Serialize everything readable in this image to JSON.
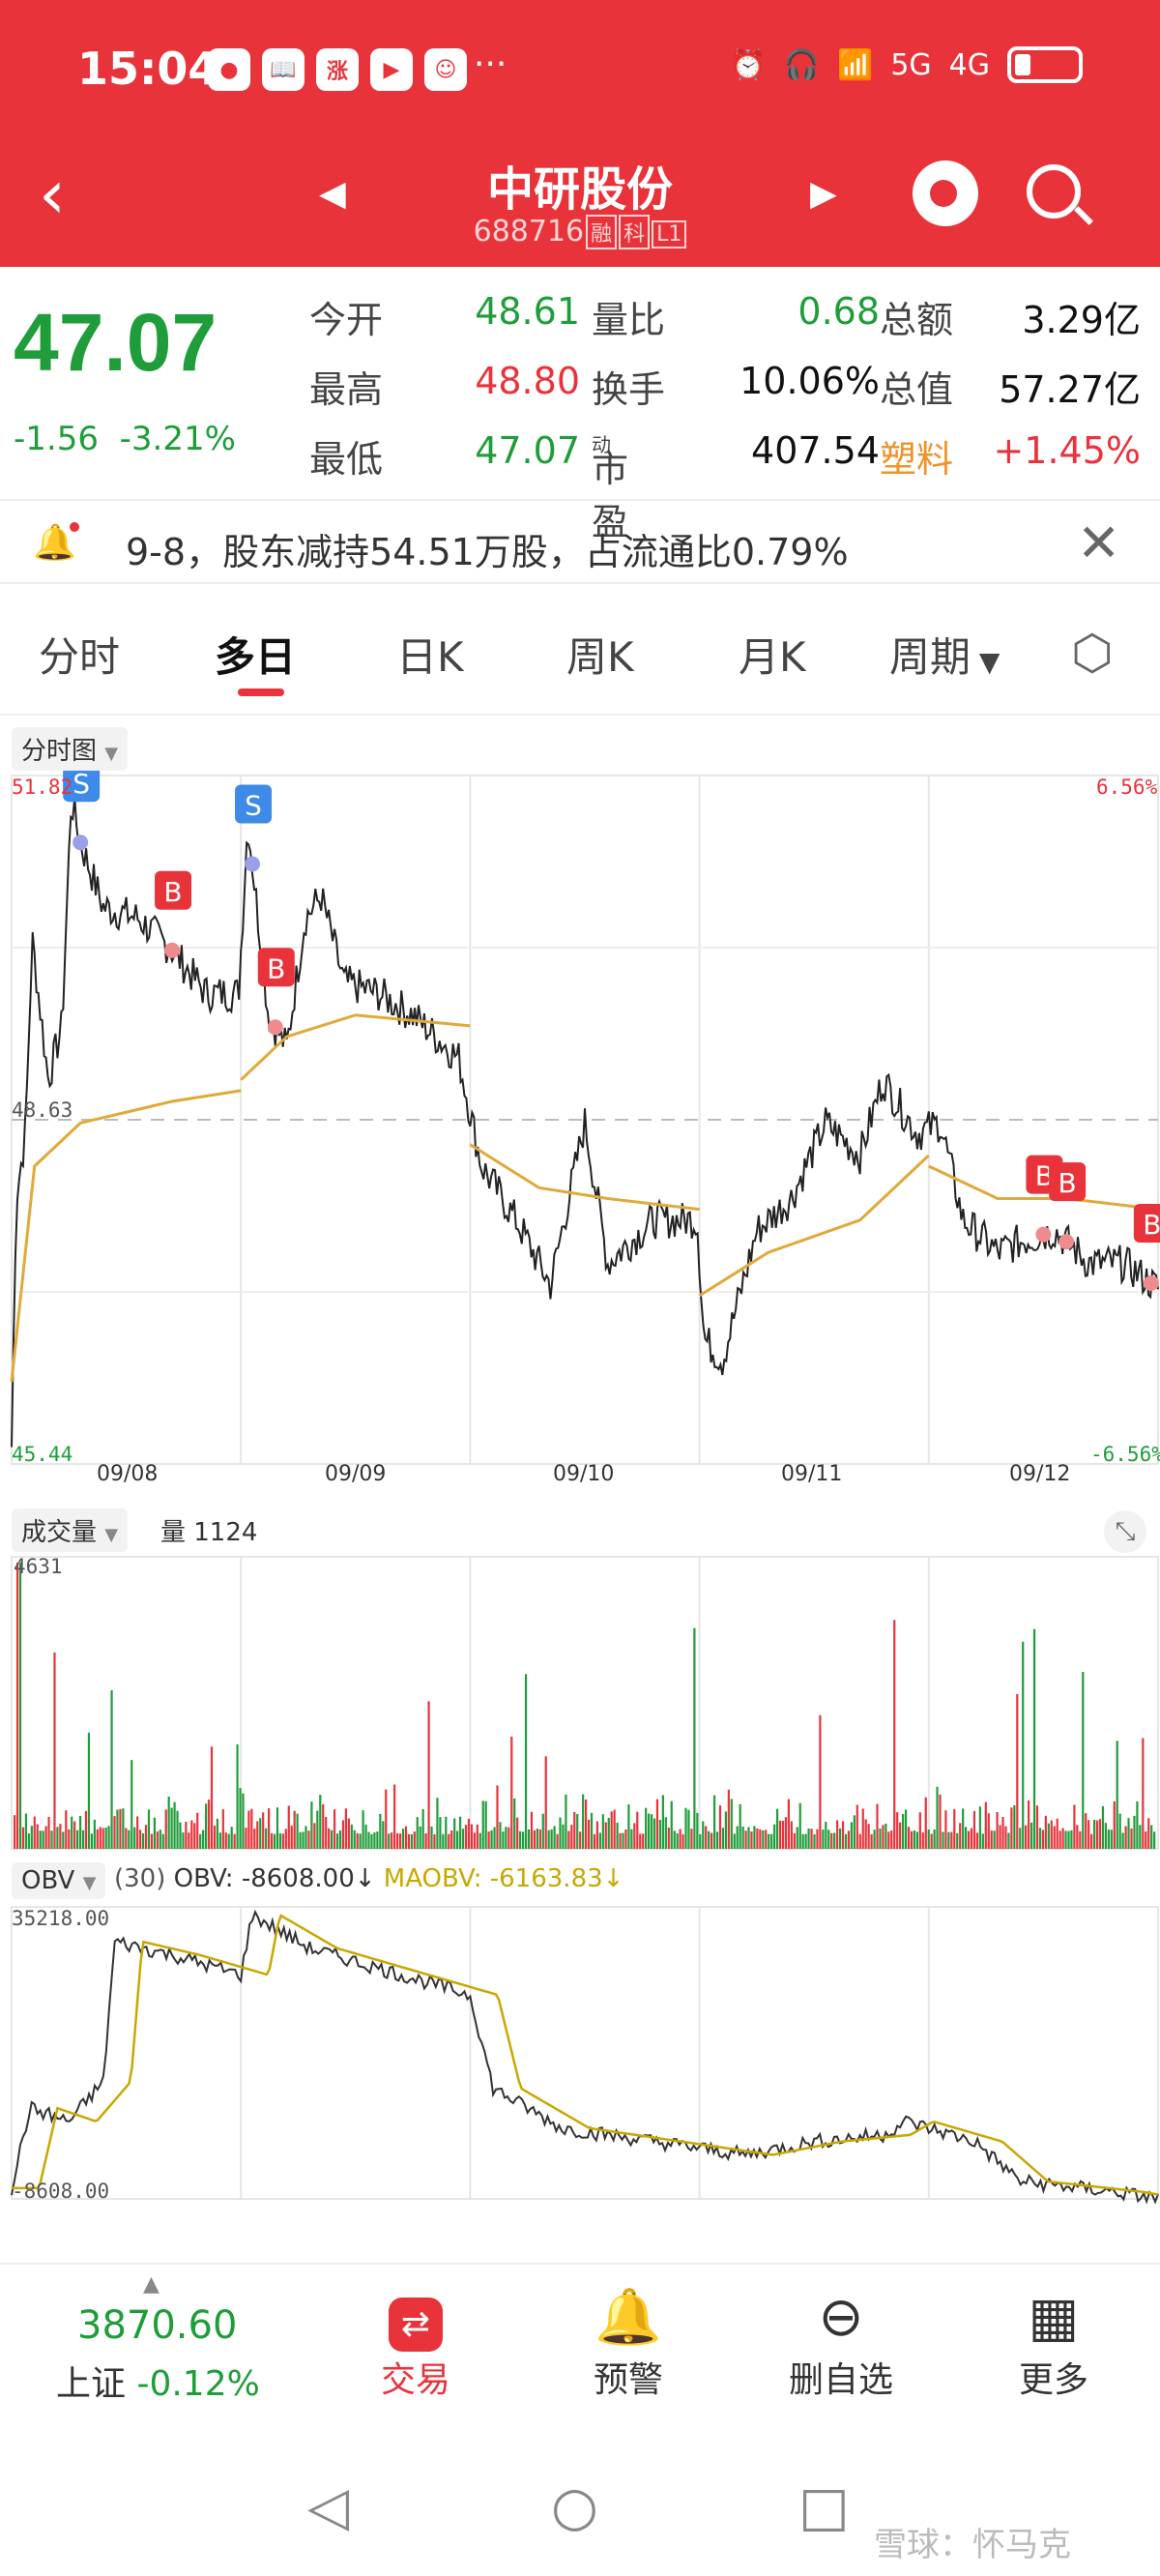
{
  "status_bar": {
    "time": "15:04",
    "app_icons": [
      "●",
      "📖",
      "涨",
      "▶",
      "☺"
    ],
    "more": "···",
    "net1": "5G",
    "net2": "4G"
  },
  "nav": {
    "title": "中研股份",
    "code": "688716",
    "tags": [
      "融",
      "科",
      "L1"
    ]
  },
  "quote": {
    "price": "47.07",
    "change": "-1.56",
    "change_pct": "-3.21%",
    "rows": [
      {
        "l1": "今开",
        "v1": "48.61",
        "l2": "量比",
        "v2": "0.68",
        "l3": "总额",
        "v3": "3.29亿"
      },
      {
        "l1": "最高",
        "v1": "48.80",
        "l2": "换手",
        "v2": "10.06%",
        "l3": "总值",
        "v3": "57.27亿"
      },
      {
        "l1": "最低",
        "v1": "47.07",
        "l2": "市盈",
        "l2_sup": "动",
        "v2": "407.54",
        "l3": "塑料",
        "v3": "+1.45%"
      }
    ]
  },
  "notice": {
    "text": "9-8，股东减持54.51万股，占流通比0.79%"
  },
  "tabs": [
    "分时",
    "多日",
    "日K",
    "周K",
    "月K",
    "周期"
  ],
  "chart": {
    "chip": "分时图",
    "y_max": "51.82",
    "y_min": "45.44",
    "y_mid": "48.63",
    "pct_max": "6.56%",
    "pct_min": "-6.56%",
    "dates": [
      "09/08",
      "09/09",
      "09/10",
      "09/11",
      "09/12"
    ],
    "markers": [
      {
        "kind": "S",
        "day": 0.3
      },
      {
        "kind": "B",
        "day": 0.7
      },
      {
        "kind": "S",
        "day": 1.05
      },
      {
        "kind": "B",
        "day": 1.15
      },
      {
        "kind": "B",
        "day": 4.5
      },
      {
        "kind": "B",
        "day": 4.6
      },
      {
        "kind": "B",
        "day": 4.97
      }
    ]
  },
  "volume": {
    "chip": "成交量",
    "label": "量 1124",
    "max": "4631"
  },
  "obv": {
    "chip": "OBV",
    "params": "(30)",
    "obv_text": "OBV: -8608.00↓",
    "maobv_text": "MAOBV: -6163.83↓",
    "max": "35218.00",
    "min": "-8608.00"
  },
  "chart_data": {
    "type": "line",
    "title": "",
    "x": [
      "09/08",
      "09/09",
      "09/10",
      "09/11",
      "09/12"
    ],
    "ylim": [
      45.44,
      51.82
    ],
    "series": [],
    "volume_ylim": [
      0,
      4631
    ],
    "obv_ylim": [
      -8608.0,
      35218.0
    ]
  },
  "bottom": {
    "index_value": "3870.60",
    "index_name": "上证",
    "index_change": "-0.12%",
    "items": [
      "交易",
      "预警",
      "删自选",
      "更多"
    ]
  },
  "watermark": "雪球：怀马克",
  "colors": {
    "up": "#e8333b",
    "down": "#1f9d3a",
    "avg": "#e0a93a"
  }
}
